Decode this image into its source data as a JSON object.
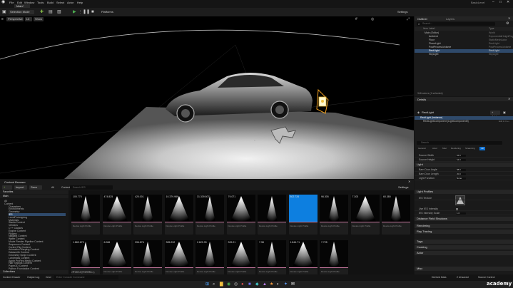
{
  "menu": {
    "items": [
      "File",
      "Edit",
      "Window",
      "Tools",
      "Build",
      "Select",
      "Actor",
      "Help"
    ],
    "project_tab": "Main*",
    "project_name": "BasicLevel"
  },
  "toolbar": {
    "selection_mode": "Selection Mode",
    "platforms": "Platforms",
    "settings": "Settings"
  },
  "viewport": {
    "perspective": "Perspective",
    "lit": "Lit",
    "show": "Show"
  },
  "outliner": {
    "title": "Outliner",
    "layers_tab": "Layers",
    "search_placeholder": "Search...",
    "col_label": "Item Label",
    "col_type": "Type",
    "rows": [
      {
        "label": "Main (Editor)",
        "type": "World"
      },
      {
        "label": "Ambient",
        "type": "ExponentialHeightFog"
      },
      {
        "label": "Floor",
        "type": "StaticMeshActor"
      },
      {
        "label": "PlaneLight",
        "type": "RectLight"
      },
      {
        "label": "PostProcessVolume",
        "type": "PostProcessVolume"
      },
      {
        "label": "RectLight",
        "type": "RectLight"
      },
      {
        "label": "SkyLight",
        "type": "SkyLight"
      }
    ],
    "footer": "346 actors (1 selected)"
  },
  "details": {
    "title": "Details",
    "actor_name": "RectLight",
    "add_label": "+ Add",
    "component_root": "RectLight (Instance)",
    "component_child": "RectLightComponent (LightComponent0)",
    "edit_in_cpp": "Edit in C++",
    "search_placeholder": "Search",
    "filter_tabs": [
      "General",
      "Actor",
      "Misc",
      "Rendering",
      "Streaming",
      "All"
    ],
    "sections": {
      "light": "Light",
      "ies": "Light Profiles",
      "distance_field": "Distance Field Shadows",
      "rendering": "Rendering",
      "ray_tracing": "Ray Tracing",
      "tags": "Tags",
      "cooking": "Cooking",
      "actor": "Actor",
      "misc": "Misc"
    },
    "rows": [
      {
        "label": "Source Width",
        "value": "64.0"
      },
      {
        "label": "Source Height",
        "value": "64.0"
      },
      {
        "label": "Barn Door Angle",
        "value": "88.0"
      },
      {
        "label": "Barn Door Length",
        "value": "20.0"
      },
      {
        "label": "Light Function",
        "value": "None"
      },
      {
        "label": "Light Profiles",
        "value": ""
      },
      {
        "label": "IES Texture",
        "value": ""
      },
      {
        "label": "Use IES Intensity",
        "value": ""
      },
      {
        "label": "IES Intensity Scale",
        "value": "1.0"
      }
    ]
  },
  "content_browser": {
    "tab1": "Content Browser",
    "add": "+ Add",
    "import": "Import",
    "save_all": "Save All",
    "breadcrumb": [
      "All",
      "Content",
      "IES"
    ],
    "settings": "Settings",
    "favorites": "Favorites",
    "collections": "Collections",
    "search_placeholder": "Search IES",
    "folder_root": "Main",
    "folders": [
      "All",
      "Content",
      "Characters",
      "Environments",
      "Geometry",
      "IES",
      "LevelPrototyping",
      "Materials",
      "StarterContent",
      "Vehicles",
      "C++ Classes",
      "Engine Content",
      "Plugins",
      "Niagara Content",
      "Water Content",
      "Movie Render Pipeline Content",
      "Sequencer Content",
      "Control Rig Content",
      "Animation Warping Content",
      "Datasmith Content",
      "Geometry Script Content",
      "Landmass Content",
      "Apple ProRes Media Content",
      "Hair Strands Content",
      "Paper2D Content",
      "Python Foundation Content"
    ],
    "tiles_row1": [
      {
        "label": "100.775",
        "name": "Device Light Profile"
      },
      {
        "label": "474.825",
        "name": "Device Light Profile"
      },
      {
        "label": "420.001",
        "name": "Device Light Profile"
      },
      {
        "label": "10.379.969",
        "name": "Device Light Profile"
      },
      {
        "label": "31.339.807",
        "name": "Device Light Profile"
      },
      {
        "label": "79.071",
        "name": "Device Light Profile"
      },
      {
        "label": "",
        "name": "Device Light Profile"
      },
      {
        "label": "802.726",
        "name": "Device Light Profile"
      },
      {
        "label": "96.305",
        "name": "Device Light Profile"
      },
      {
        "label": "7.303",
        "name": "Device Light Profile"
      },
      {
        "label": "60.380",
        "name": "Device Light Profile"
      }
    ],
    "tiles_row2": [
      {
        "label": "1.869.673",
        "name": "Device Light Profile"
      },
      {
        "label": "6.066",
        "name": "Device Light Profile"
      },
      {
        "label": "996.876",
        "name": "Device Light Profile"
      },
      {
        "label": "305.232",
        "name": "Device Light Profile"
      },
      {
        "label": "2.629.33",
        "name": "Device Light Profile"
      },
      {
        "label": "329.21",
        "name": "Device Light Profile"
      },
      {
        "label": "7.38",
        "name": "Device Light Profile"
      },
      {
        "label": "1.844.71",
        "name": "Device Light Profile"
      },
      {
        "label": "7.725",
        "name": "Device Light Profile"
      }
    ],
    "items_count": "20 items (1 selected)"
  },
  "status": {
    "content_drawer": "Content Drawer",
    "output_log": "Output Log",
    "cmd": "Cmd",
    "console_placeholder": "Enter Console Command",
    "derived_data": "Derived Data",
    "unsaved": "2 Unsaved",
    "source_control": "Source Control"
  },
  "watermark": "academy"
}
